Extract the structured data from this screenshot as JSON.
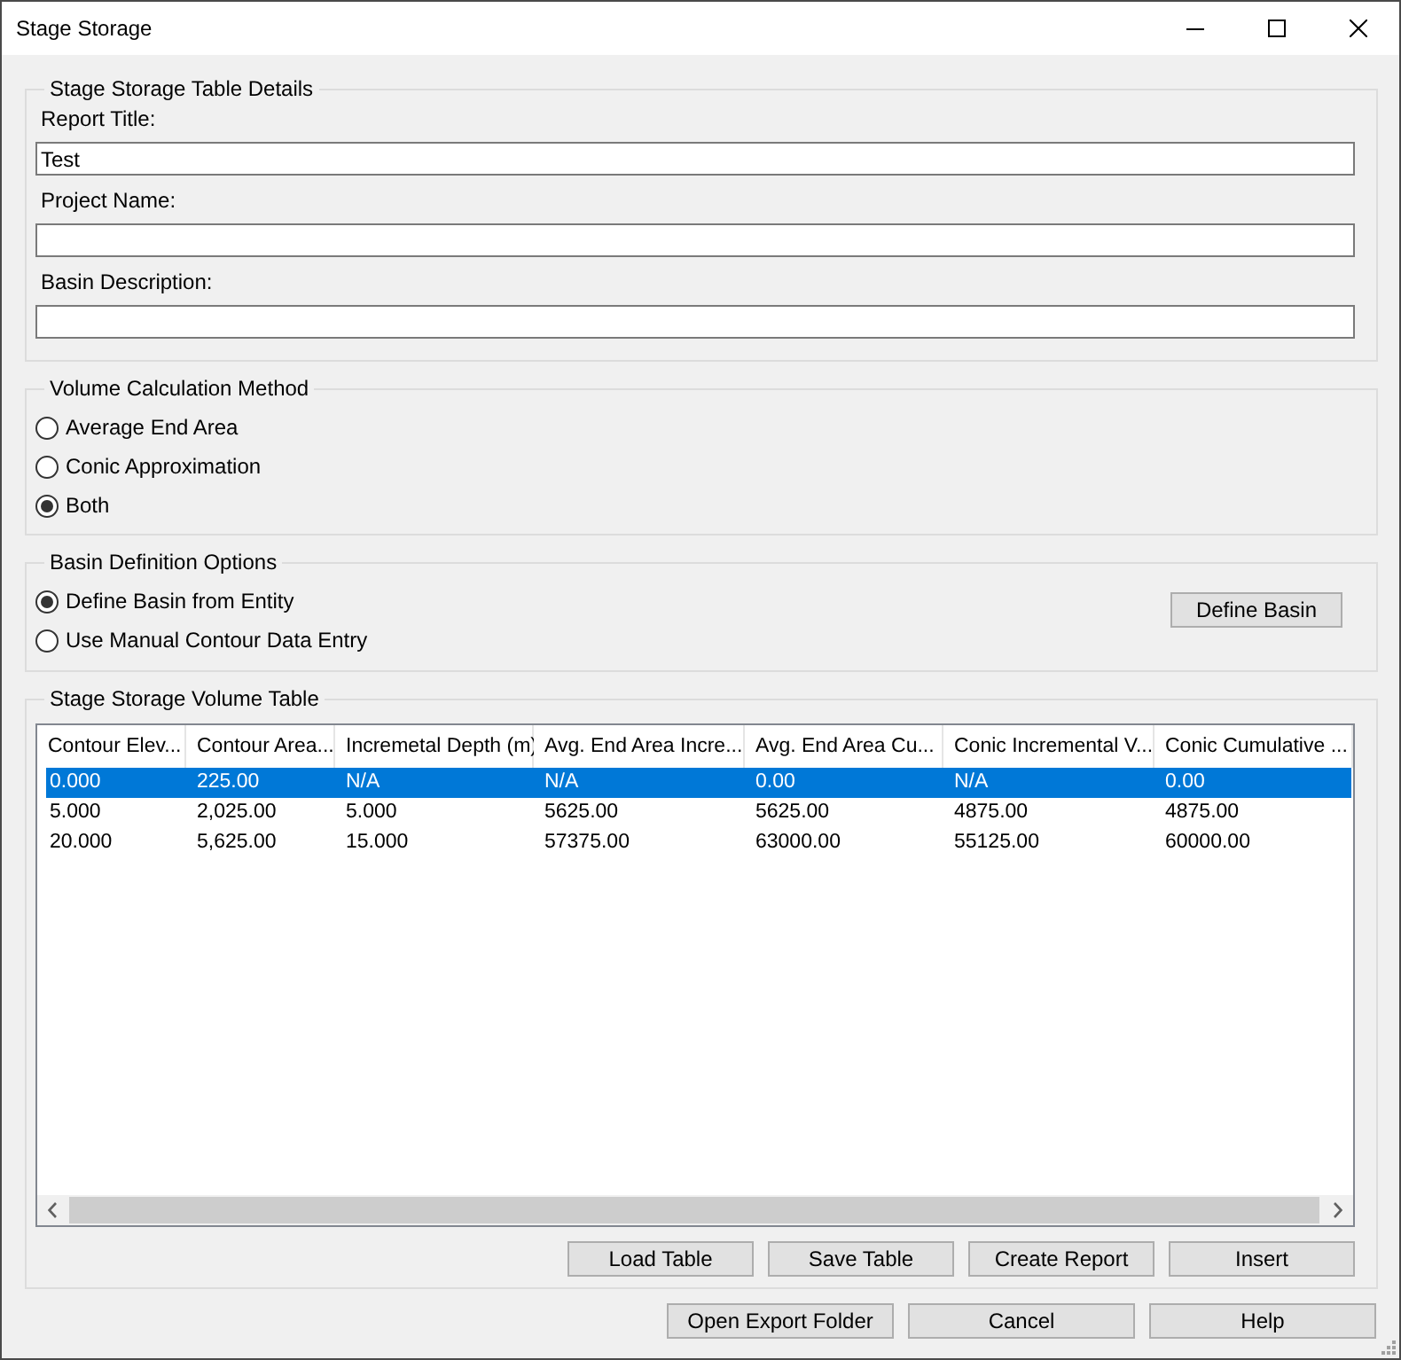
{
  "window": {
    "title": "Stage Storage"
  },
  "table_details": {
    "title": "Stage Storage Table Details",
    "fields": [
      {
        "label": "Report Title:",
        "value": "Test"
      },
      {
        "label": "Project Name:"
      },
      {
        "label": "Basin Description:"
      }
    ]
  },
  "volume_calculation_method": {
    "title": "Volume Calculation Method",
    "options": [
      {
        "label": "Average End Area",
        "selected": false
      },
      {
        "label": "Conic Approximation",
        "selected": false
      },
      {
        "label": "Both",
        "selected": true
      }
    ]
  },
  "basin_definition_options": {
    "title": "Basin Definition Options",
    "options": [
      {
        "label": "Define Basin from Entity",
        "selected": true
      },
      {
        "label": "Use Manual Contour Data Entry",
        "selected": false
      }
    ],
    "button": "Define Basin"
  },
  "volume_table": {
    "title": "Stage Storage Volume Table",
    "columns": [
      "Contour Elev...",
      "Contour Area...",
      "Incremetal Depth (m)",
      "Avg. End Area Incre...",
      "Avg. End Area Cu...",
      "Conic Incremental V...",
      "Conic Cumulative ..."
    ],
    "rows": [
      {
        "selected": true,
        "cells": [
          "0.000",
          "225.00",
          "N/A",
          "N/A",
          "0.00",
          "N/A",
          "0.00"
        ]
      },
      {
        "selected": false,
        "cells": [
          "5.000",
          "2,025.00",
          "5.000",
          "5625.00",
          "5625.00",
          "4875.00",
          "4875.00"
        ]
      },
      {
        "selected": false,
        "cells": [
          "20.000",
          "5,625.00",
          "15.000",
          "57375.00",
          "63000.00",
          "55125.00",
          "60000.00"
        ]
      }
    ],
    "buttons": [
      "Load Table",
      "Save Table",
      "Create Report",
      "Insert"
    ]
  },
  "buttons": [
    "Open Export Folder",
    "Cancel",
    "Help"
  ]
}
